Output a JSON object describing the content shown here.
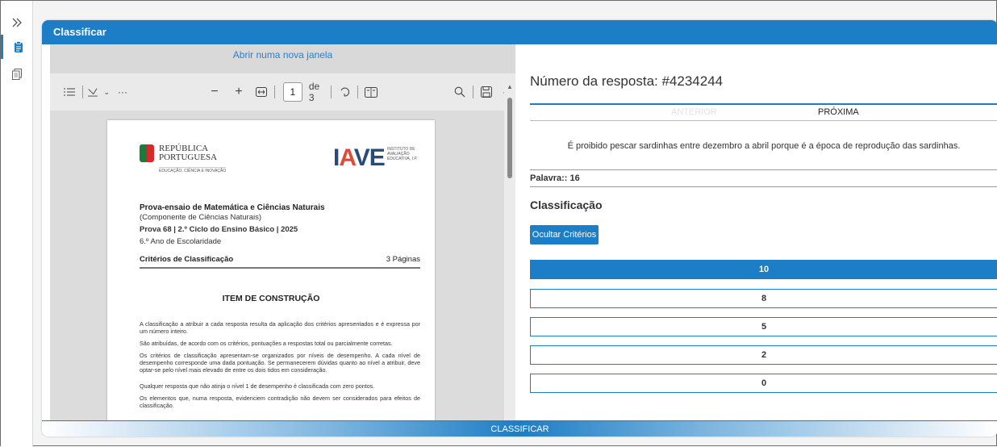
{
  "rail": {
    "expand_icon": "double-chevron-right-icon",
    "items": [
      {
        "icon": "clipboard-icon"
      },
      {
        "icon": "documents-icon"
      }
    ]
  },
  "card": {
    "title": "Classificar"
  },
  "viewer": {
    "open_link": "Abrir numa nova janela",
    "toolbar": {
      "contents_icon": "list-icon",
      "draw_icon": "highlight-icon",
      "more": "···",
      "zoom_out": "−",
      "zoom_in": "+",
      "page_current": "1",
      "page_total": "de 3",
      "rotate_icon": "rotate-icon",
      "view_icon": "two-page-icon",
      "search_icon": "search-icon",
      "save_icon": "save-icon",
      "more2": "···"
    },
    "document": {
      "header_left_line1": "REPÚBLICA",
      "header_left_line2": "PORTUGUESA",
      "header_left_sub": "EDUCAÇÃO, CIÊNCIA E INOVAÇÃO",
      "iave_logo_i": "I",
      "iave_logo_a": "A",
      "iave_logo_ve": "VE",
      "iave_sub": "INSTITUTO DE AVALIAÇÃO EDUCATIVA, I.P.",
      "title": "Prova-ensaio de Matemática e Ciências Naturais",
      "subtitle": "(Componente de Ciências Naturais)",
      "prova": "Prova 68 | 2.º Ciclo do Ensino Básico | 2025",
      "ano": "6.º Ano de Escolaridade",
      "criteria": "Critérios de Classificação",
      "pages": "3 Páginas",
      "item_title": "ITEM DE CONSTRUÇÃO",
      "paragraphs": [
        "A classificação a atribuir a cada resposta resulta da aplicação dos critérios apresentados e é expressa por um número inteiro.",
        "São atribuídas, de acordo com os critérios, pontuações a respostas total ou parcialmente corretas.",
        "Os critérios de classificação apresentam-se organizados por níveis de desempenho. A cada nível de desempenho corresponde uma dada pontuação. Se permanecerem dúvidas quanto ao nível a atribuir, deve optar-se pelo nível mais elevado de entre os dois tidos em consideração.",
        "Qualquer resposta que não atinja o nível 1 de desempenho é classificada com zero pontos.",
        "Os elementos que, numa resposta, evidenciem contradição não devem ser considerados para efeitos de classificação."
      ]
    }
  },
  "response": {
    "number_label": "Número da resposta: #4234244",
    "prev": "ANTERIOR",
    "next": "PRÓXIMA",
    "text": "É proibido pescar sardinhas entre dezembro a abril porque é a época de reprodução das sardinhas.",
    "words": "Palavra:: 16",
    "classification_title": "Classificação",
    "hide_criteria": "Ocultar Critérios",
    "scores": [
      "10",
      "8",
      "5",
      "2",
      "0"
    ],
    "selected_score": "10"
  },
  "submit": {
    "label": "CLASSIFICAR"
  }
}
